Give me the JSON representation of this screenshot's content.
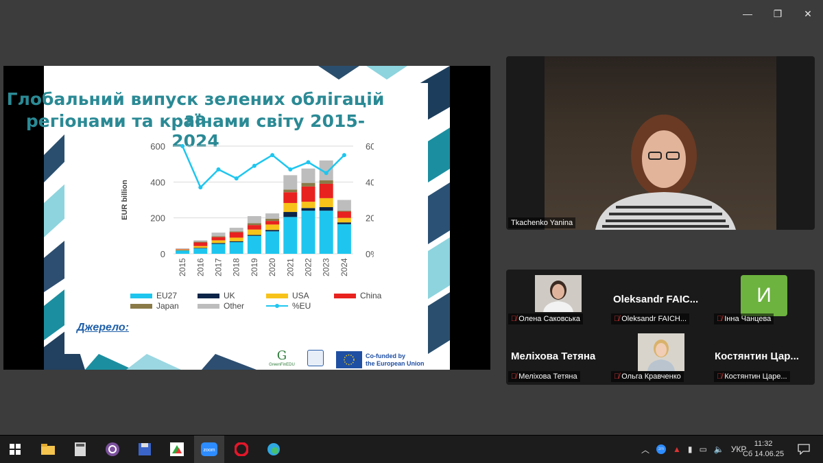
{
  "slide": {
    "title_line1": "Глобальний випуск зелених облігацій за",
    "title_line2": "регіонами та країнами світу 2015-2024",
    "source_label": "Джерело:",
    "cofunded": "Co-funded by",
    "eu": "the European Union",
    "logo1": "GreenFinEDU"
  },
  "chart_data": {
    "type": "bar",
    "stacked": true,
    "categories": [
      "2015",
      "2016",
      "2017",
      "2018",
      "2019",
      "2020",
      "2021",
      "2022",
      "2023",
      "2024"
    ],
    "ylabel": "EUR billion",
    "ylim": [
      0,
      600
    ],
    "y_ticks": [
      "600",
      "400",
      "200",
      "0"
    ],
    "y2lim": [
      0,
      60
    ],
    "y2_ticks": [
      "60%",
      "40%",
      "20%",
      "0%"
    ],
    "series": [
      {
        "name": "EU27",
        "color": "#1ec6ef",
        "values": [
          18,
          30,
          55,
          65,
          100,
          125,
          205,
          240,
          240,
          165
        ]
      },
      {
        "name": "UK",
        "color": "#0b2447",
        "values": [
          2,
          3,
          5,
          5,
          5,
          8,
          28,
          15,
          20,
          10
        ]
      },
      {
        "name": "USA",
        "color": "#f7c31a",
        "values": [
          3,
          10,
          15,
          20,
          30,
          30,
          50,
          35,
          50,
          25
        ]
      },
      {
        "name": "China",
        "color": "#e8221f",
        "values": [
          2,
          20,
          18,
          30,
          25,
          20,
          60,
          85,
          80,
          35
        ]
      },
      {
        "name": "Japan",
        "color": "#8a7a48",
        "values": [
          1,
          4,
          5,
          5,
          10,
          12,
          15,
          20,
          20,
          5
        ]
      },
      {
        "name": "Other",
        "color": "#bdbdbd",
        "values": [
          4,
          8,
          20,
          20,
          40,
          30,
          80,
          80,
          110,
          60
        ]
      }
    ],
    "line": {
      "name": "%EU",
      "color": "#1ec6ef",
      "values": [
        60,
        37,
        47,
        42,
        49,
        55,
        47,
        51,
        45,
        55
      ]
    }
  },
  "participants": {
    "main": {
      "name": "Tkachenko Yanina"
    },
    "tiles": [
      {
        "name": "Олена Саковська"
      },
      {
        "display": "Oleksandr  FAIC...",
        "name": "Oleksandr FAICH..."
      },
      {
        "initial": "И",
        "name": "Інна Чанцева"
      },
      {
        "display": "Меліхова Тетяна",
        "name": "Меліхова Тетяна"
      },
      {
        "name": "Ольга Кравченко"
      },
      {
        "display": "Костянтин  Цар...",
        "name": "Костянтин Царе..."
      }
    ]
  },
  "taskbar": {
    "lang": "УКР",
    "time": "11:32",
    "date": "Сб 14.06.25"
  }
}
